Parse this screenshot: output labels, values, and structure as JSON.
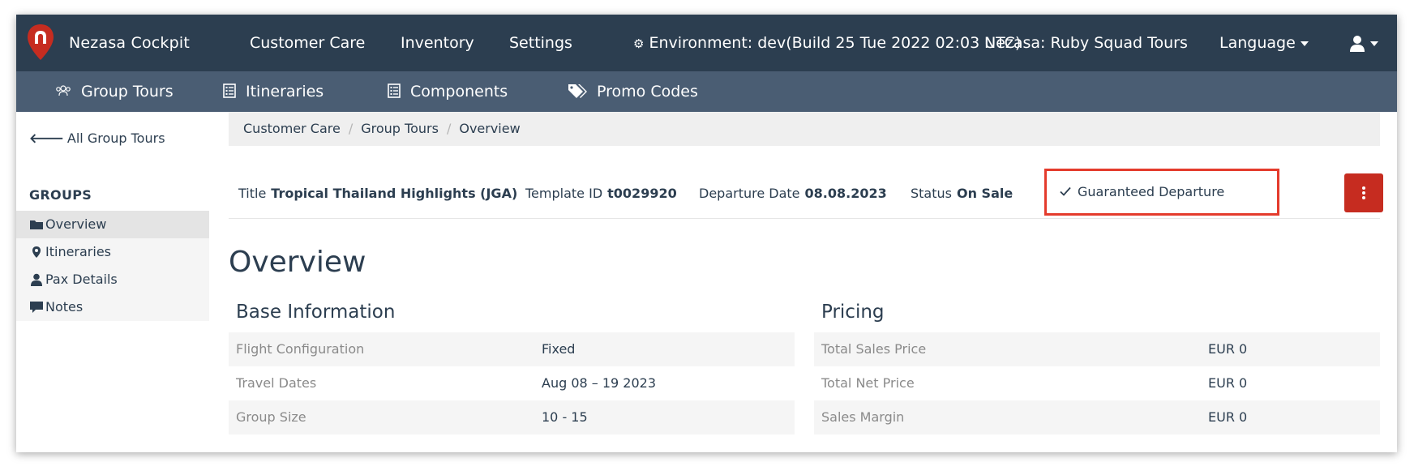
{
  "topbar": {
    "brand": "Nezasa Cockpit",
    "nav": [
      "Customer Care",
      "Inventory",
      "Settings"
    ],
    "environment": "Environment: dev(Build 25 Tue 2022 02:03 UTC)",
    "tenant": "Nezasa: Ruby Squad Tours",
    "language": "Language",
    "colors": {
      "bg": "#2c3e50",
      "logo": "#c62c20"
    }
  },
  "subnav": {
    "items": [
      {
        "label": "Group Tours",
        "icon": "group-icon"
      },
      {
        "label": "Itineraries",
        "icon": "list-icon"
      },
      {
        "label": "Components",
        "icon": "list-icon"
      },
      {
        "label": "Promo Codes",
        "icon": "tags-icon"
      }
    ]
  },
  "sidebar": {
    "back": "All Group Tours",
    "heading": "GROUPS",
    "items": [
      {
        "label": "Overview",
        "icon": "folder-icon",
        "active": true
      },
      {
        "label": "Itineraries",
        "icon": "map-marker-icon"
      },
      {
        "label": "Pax Details",
        "icon": "user-icon"
      },
      {
        "label": "Notes",
        "icon": "comment-icon"
      }
    ]
  },
  "breadcrumb": [
    "Customer Care",
    "Group Tours",
    "Overview"
  ],
  "info": {
    "title_label": "Title",
    "title_value": "Tropical Thailand Highlights (JGA)",
    "template_label": "Template ID",
    "template_value": "t0029920",
    "departure_label": "Departure Date",
    "departure_value": "08.08.2023",
    "status_label": "Status",
    "status_value": "On Sale",
    "guaranteed": "Guaranteed Departure"
  },
  "overview_heading": "Overview",
  "base_info": {
    "title": "Base Information",
    "rows": [
      {
        "label": "Flight Configuration",
        "value": "Fixed"
      },
      {
        "label": "Travel Dates",
        "value": "Aug 08 – 19 2023"
      },
      {
        "label": "Group Size",
        "value": "10 - 15"
      }
    ]
  },
  "pricing": {
    "title": "Pricing",
    "rows": [
      {
        "label": "Total Sales Price",
        "value": "EUR 0"
      },
      {
        "label": "Total Net Price",
        "value": "EUR 0"
      },
      {
        "label": "Sales Margin",
        "value": "EUR 0"
      }
    ]
  }
}
